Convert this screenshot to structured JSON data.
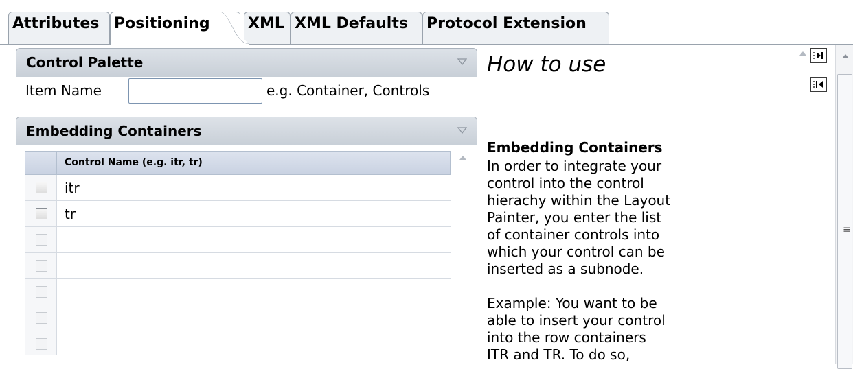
{
  "tabs": [
    {
      "label": "Attributes"
    },
    {
      "label": "Positioning"
    },
    {
      "label": "XML"
    },
    {
      "label": "XML Defaults"
    },
    {
      "label": "Protocol Extension"
    }
  ],
  "control_palette": {
    "title": "Control Palette",
    "item_name_label": "Item Name",
    "item_name_value": "",
    "item_name_hint": "e.g. Container, Controls"
  },
  "embedding": {
    "title": "Embedding Containers",
    "column_header": "Control Name (e.g. itr, tr)",
    "rows": [
      {
        "name": "itr"
      },
      {
        "name": "tr"
      },
      {
        "name": ""
      },
      {
        "name": ""
      },
      {
        "name": ""
      },
      {
        "name": ""
      },
      {
        "name": ""
      }
    ]
  },
  "help": {
    "title": "How to use",
    "heading": "Embedding Containers",
    "paragraph1": "In order to integrate your control into the control hierachy within the Layout Painter, you enter the list of container controls into which your control can be inserted as a subnode.",
    "paragraph2": "Example: You want to be able to insert your control into the row containers ITR and TR. To do so,"
  },
  "icons": {
    "collapse": "triangle-down-icon",
    "scroll_up": "scroll-up-icon",
    "expand_pane": "expand-pane-icon",
    "collapse_pane": "collapse-pane-icon"
  },
  "colors": {
    "section_header": "#d3d9e0",
    "table_header": "#d2d9e6",
    "border": "#9aa3ad"
  }
}
